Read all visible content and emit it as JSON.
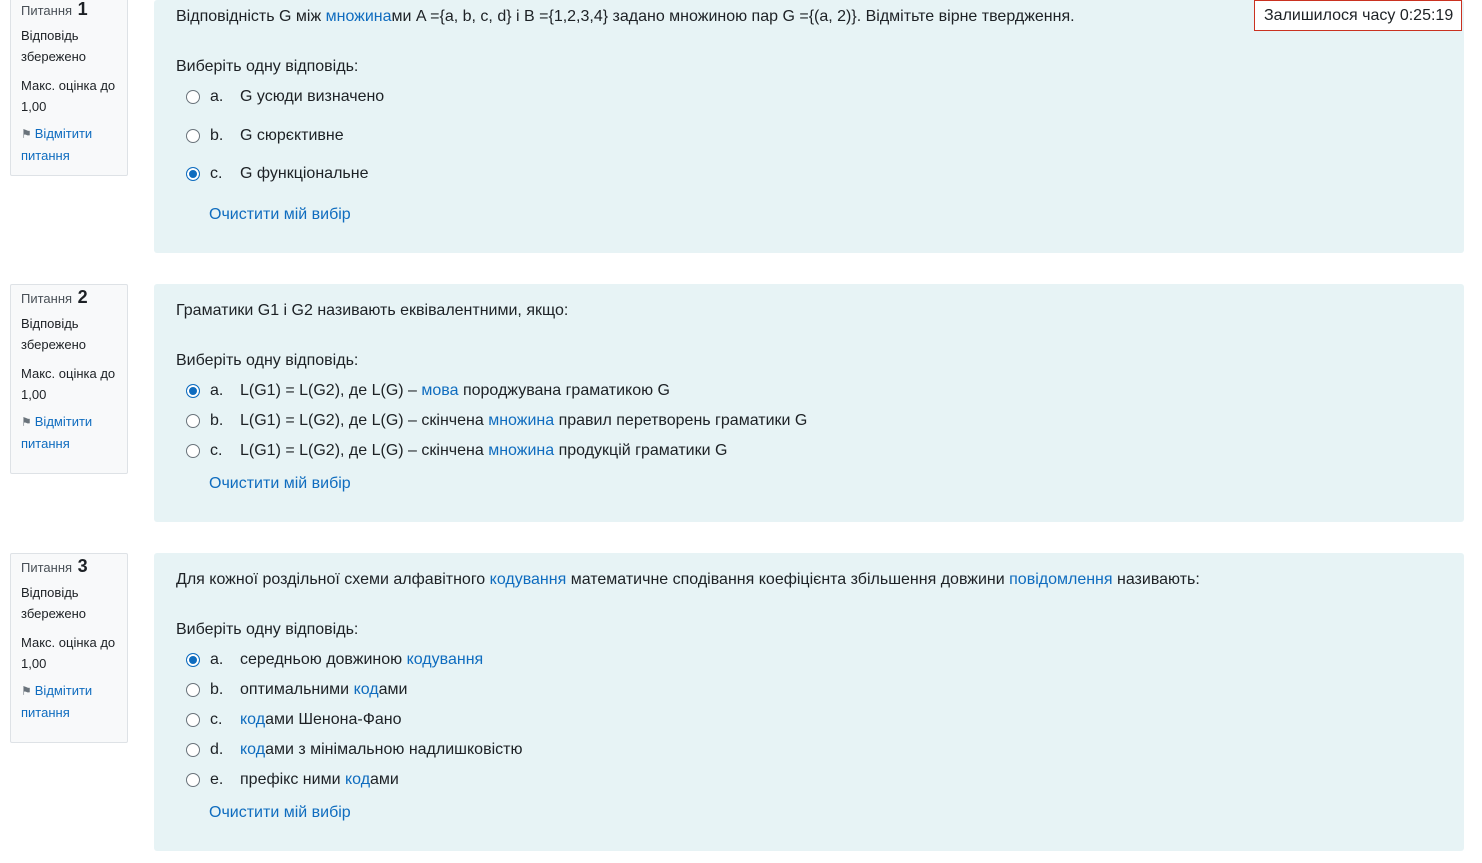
{
  "timer": {
    "label": "Залишилося часу",
    "value": "0:25:19"
  },
  "questions": [
    {
      "label": "Питання",
      "number": "1",
      "state": "Відповідь збережено",
      "grade": "Макс. оцінка до 1,00",
      "flag": "Відмітити питання",
      "text": [
        {
          "t": "Відповідність G між "
        },
        {
          "t": "множина",
          "link": true
        },
        {
          "t": "ми A ={a, b, c, d} і B ={1,2,3,4} задано множиною пар G ={(a, 2)}. Відмітьте вірне твердження."
        }
      ],
      "prompt": "Виберіть одну відповідь:",
      "answers": [
        {
          "letter": "a.",
          "checked": false,
          "parts": [
            {
              "t": "G усюди визначено"
            }
          ]
        },
        {
          "letter": "b.",
          "checked": false,
          "parts": [
            {
              "t": "G сюрєктивне"
            }
          ]
        },
        {
          "letter": "c.",
          "checked": true,
          "parts": [
            {
              "t": "G функціональне"
            }
          ]
        }
      ],
      "clear": "Очистити мій вибір"
    },
    {
      "label": "Питання",
      "number": "2",
      "state": "Відповідь збережено",
      "grade": "Макс. оцінка до 1,00",
      "flag": "Відмітити питання",
      "text": [
        {
          "t": "Граматики G1 і G2 називають еквівалентними, якщо:"
        }
      ],
      "prompt": "Виберіть одну відповідь:",
      "answers": [
        {
          "letter": "a.",
          "checked": true,
          "parts": [
            {
              "t": "L(G1) = L(G2), де L(G) – "
            },
            {
              "t": "мова",
              "link": true
            },
            {
              "t": " породжувана граматикою G"
            }
          ]
        },
        {
          "letter": "b.",
          "checked": false,
          "parts": [
            {
              "t": "L(G1) = L(G2), де L(G) – скінчена "
            },
            {
              "t": "множина",
              "link": true
            },
            {
              "t": " правил перетворень граматики G"
            }
          ]
        },
        {
          "letter": "c.",
          "checked": false,
          "parts": [
            {
              "t": "L(G1) = L(G2), де L(G) – скінчена "
            },
            {
              "t": "множина",
              "link": true
            },
            {
              "t": " продукцій граматики G"
            }
          ]
        }
      ],
      "clear": "Очистити мій вибір"
    },
    {
      "label": "Питання",
      "number": "3",
      "state": "Відповідь збережено",
      "grade": "Макс. оцінка до 1,00",
      "flag": "Відмітити питання",
      "text": [
        {
          "t": "Для кожної роздільної схеми алфавітного "
        },
        {
          "t": "кодування",
          "link": true
        },
        {
          "t": " математичне сподівання коефіцієнта збільшення довжини "
        },
        {
          "t": "повідомлення",
          "link": true
        },
        {
          "t": " називають:"
        }
      ],
      "prompt": "Виберіть одну відповідь:",
      "answers": [
        {
          "letter": "a.",
          "checked": true,
          "parts": [
            {
              "t": "середньою довжиною "
            },
            {
              "t": "кодування",
              "link": true
            }
          ]
        },
        {
          "letter": "b.",
          "checked": false,
          "parts": [
            {
              "t": "оптимальними "
            },
            {
              "t": "код",
              "link": true
            },
            {
              "t": "ами"
            }
          ]
        },
        {
          "letter": "c.",
          "checked": false,
          "parts": [
            {
              "t": "код",
              "link": true
            },
            {
              "t": "ами Шенона-Фано"
            }
          ]
        },
        {
          "letter": "d.",
          "checked": false,
          "parts": [
            {
              "t": "код",
              "link": true
            },
            {
              "t": "ами з мінімальною надлишковістю"
            }
          ]
        },
        {
          "letter": "e.",
          "checked": false,
          "parts": [
            {
              "t": "префікс ними "
            },
            {
              "t": "код",
              "link": true
            },
            {
              "t": "ами"
            }
          ]
        }
      ],
      "clear": "Очистити мій вибір"
    }
  ]
}
